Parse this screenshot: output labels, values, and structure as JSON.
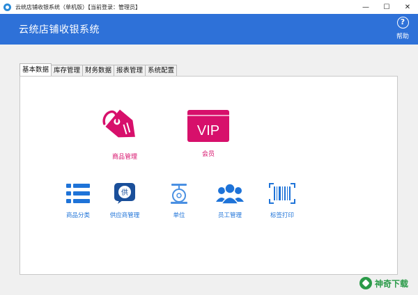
{
  "window": {
    "title": "云统店铺收银系统（单机版）【当前登录：管理员】",
    "controls": {
      "minimize": "—",
      "maximize": "☐",
      "close": "✕"
    }
  },
  "header": {
    "title": "云统店铺收银系统",
    "help_label": "帮助",
    "help_icon": "?",
    "background_color": "#2e71d8"
  },
  "tabs": [
    {
      "label": "基本数据",
      "active": true
    },
    {
      "label": "库存管理",
      "active": false
    },
    {
      "label": "财务数据",
      "active": false
    },
    {
      "label": "报表管理",
      "active": false
    },
    {
      "label": "系统配置",
      "active": false
    }
  ],
  "main_items": [
    {
      "label": "商品管理",
      "icon": "price-tag-icon",
      "color": "#d7106b"
    },
    {
      "label": "会员",
      "icon": "vip-card-icon",
      "icon_text": "VIP",
      "color": "#d7106b"
    }
  ],
  "secondary_items": [
    {
      "label": "商品分类",
      "icon": "category-list-icon",
      "color": "#1e73d8"
    },
    {
      "label": "供应商管理",
      "icon": "supplier-chat-icon",
      "icon_text": "供",
      "color": "#1e73d8"
    },
    {
      "label": "单位",
      "icon": "scale-icon",
      "color": "#1e73d8"
    },
    {
      "label": "员工管理",
      "icon": "staff-group-icon",
      "color": "#1e73d8"
    },
    {
      "label": "标签打印",
      "icon": "barcode-icon",
      "color": "#1e73d8"
    }
  ],
  "watermark": {
    "text": "神奇下载"
  }
}
